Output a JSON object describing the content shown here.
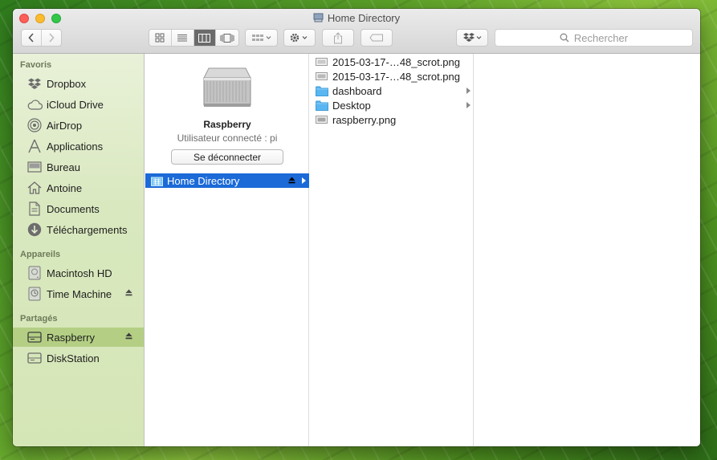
{
  "window": {
    "title": "Home Directory"
  },
  "toolbar": {
    "search_placeholder": "Rechercher",
    "icons": [
      "chevron-left-icon",
      "chevron-right-icon",
      "icon-view-icon",
      "list-view-icon",
      "column-view-icon",
      "cover-flow-icon",
      "arrange-icon",
      "gear-icon",
      "share-icon",
      "tag-icon",
      "dropbox-icon",
      "search-icon"
    ],
    "active_view": "column-view"
  },
  "sidebar": {
    "sections": [
      {
        "header": "Favoris",
        "items": [
          {
            "label": "Dropbox",
            "icon": "dropbox-icon"
          },
          {
            "label": "iCloud Drive",
            "icon": "cloud-icon"
          },
          {
            "label": "AirDrop",
            "icon": "airdrop-icon"
          },
          {
            "label": "Applications",
            "icon": "applications-icon"
          },
          {
            "label": "Bureau",
            "icon": "desktop-icon"
          },
          {
            "label": "Antoine",
            "icon": "home-icon"
          },
          {
            "label": "Documents",
            "icon": "document-icon"
          },
          {
            "label": "Téléchargements",
            "icon": "download-icon"
          }
        ]
      },
      {
        "header": "Appareils",
        "items": [
          {
            "label": "Macintosh HD",
            "icon": "hard-drive-icon"
          },
          {
            "label": "Time Machine",
            "icon": "time-machine-icon"
          }
        ]
      },
      {
        "header": "Partagés",
        "items": [
          {
            "label": "Raspberry",
            "icon": "server-icon",
            "selected": true
          },
          {
            "label": "DiskStation",
            "icon": "server-icon"
          }
        ]
      }
    ]
  },
  "column1": {
    "server_name": "Raspberry",
    "connected_user": "Utilisateur connecté : pi",
    "disconnect_label": "Se déconnecter",
    "selected_item": "Home Directory"
  },
  "column2": {
    "items": [
      {
        "name": "2015-03-17-…48_scrot.png",
        "type": "image"
      },
      {
        "name": "2015-03-17-…48_scrot.png",
        "type": "image"
      },
      {
        "name": "dashboard",
        "type": "folder"
      },
      {
        "name": "Desktop",
        "type": "folder"
      },
      {
        "name": "raspberry.png",
        "type": "image"
      }
    ]
  },
  "colors": {
    "selection_blue": "#1b6ad8",
    "sidebar_selected": "#b4cf84",
    "folder_blue": "#5ab6f0"
  }
}
